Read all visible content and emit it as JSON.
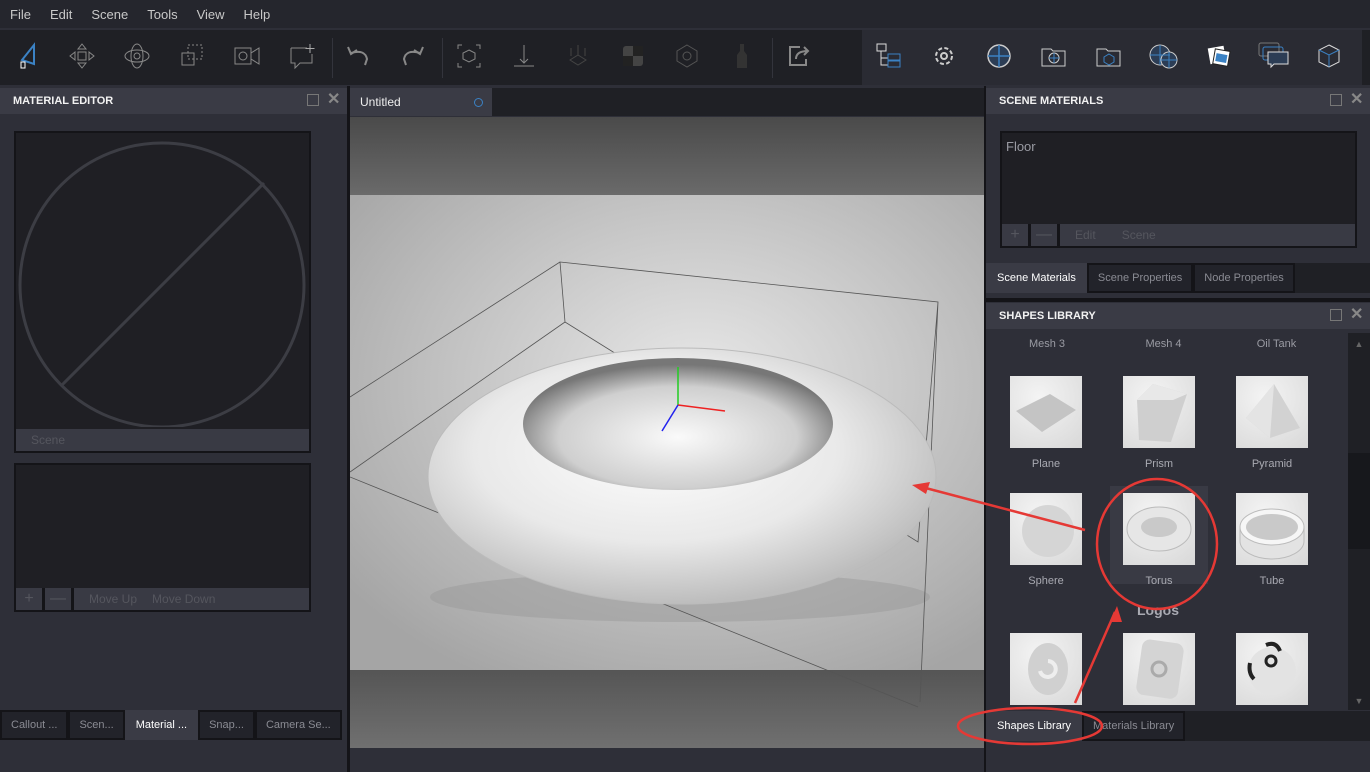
{
  "menu": [
    "File",
    "Edit",
    "Scene",
    "Tools",
    "View",
    "Help"
  ],
  "toolbar": {
    "left_icons": [
      "select-icon",
      "move-icon",
      "orbit-icon",
      "scale-icon",
      "camera-video-icon",
      "add-callout-icon",
      "undo-icon",
      "redo-icon",
      "frame-selection-icon",
      "drop-to-floor-icon",
      "explode-icon",
      "checker-icon",
      "pivot-icon",
      "bottle-icon",
      "export-icon"
    ],
    "right_icons": [
      "scene-tree-icon",
      "settings-icon",
      "environment-icon",
      "camera-folder-icon",
      "model-folder-icon",
      "environments-icon",
      "images-icon",
      "callouts-icon",
      "cube-icon"
    ]
  },
  "material_editor": {
    "title": "MATERIAL EDITOR",
    "preview_label": "Scene",
    "move_up": "Move Up",
    "move_down": "Move Down",
    "add": "+",
    "remove": "—"
  },
  "left_tabs": [
    {
      "label": "Callout ...",
      "active": false
    },
    {
      "label": "Scen...",
      "active": false
    },
    {
      "label": "Material ...",
      "active": true
    },
    {
      "label": "Snap...",
      "active": false
    },
    {
      "label": "Camera Se...",
      "active": false
    }
  ],
  "viewport": {
    "tab": "Untitled"
  },
  "scene_materials": {
    "title": "SCENE MATERIALS",
    "items": [
      "Floor"
    ],
    "edit": "Edit",
    "scene": "Scene",
    "add": "+",
    "remove": "—"
  },
  "right_top_tabs": [
    {
      "label": "Scene Materials",
      "active": true
    },
    {
      "label": "Scene Properties",
      "active": false
    },
    {
      "label": "Node Properties",
      "active": false
    }
  ],
  "shapes_library": {
    "title": "SHAPES LIBRARY",
    "top_labels": [
      "Mesh 3",
      "Mesh 4",
      "Oil Tank"
    ],
    "shapes": [
      "Plane",
      "Prism",
      "Pyramid",
      "Sphere",
      "Torus",
      "Tube"
    ],
    "section": "Logos",
    "selected": "Torus"
  },
  "right_bottom_tabs": [
    {
      "label": "Shapes Library",
      "active": true
    },
    {
      "label": "Materials Library",
      "active": false
    }
  ],
  "colors": {
    "accent": "#3b82c4",
    "annotation": "#e53935"
  }
}
